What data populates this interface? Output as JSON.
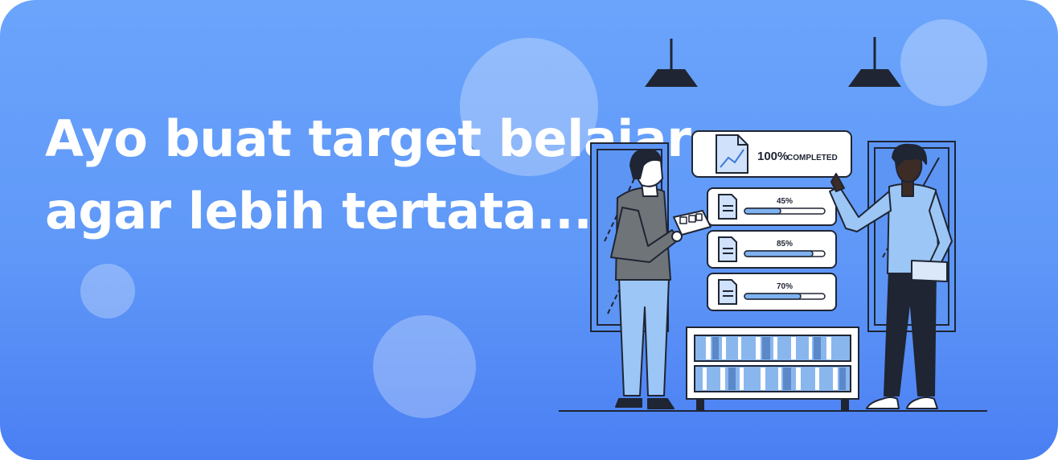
{
  "banner": {
    "headline_line1": "Ayo buat target belajar",
    "headline_line2": "agar lebih tertata..."
  },
  "illustration": {
    "completed_percent": "100%",
    "completed_label": "COMPLETED",
    "progress_items": [
      {
        "label": "45%",
        "value": 0.45
      },
      {
        "label": "85%",
        "value": 0.85
      },
      {
        "label": "70%",
        "value": 0.7
      }
    ]
  },
  "colors": {
    "background_top": "#6aa4fb",
    "background_bottom": "#4a7ff3",
    "ink": "#1f2533",
    "accent_light": "#b9d4fb",
    "accent_mid": "#7fb2f0"
  }
}
